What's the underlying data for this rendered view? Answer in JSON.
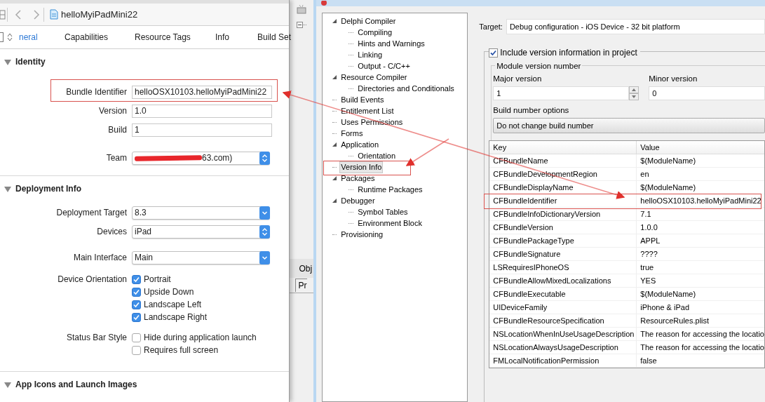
{
  "xcode": {
    "file_name": "helloMyiPadMini22",
    "tabs": [
      {
        "label": "neral",
        "selected": true
      },
      {
        "label": "Capabilities",
        "selected": false
      },
      {
        "label": "Resource Tags",
        "selected": false
      },
      {
        "label": "Info",
        "selected": false
      },
      {
        "label": "Build Set",
        "selected": false
      }
    ],
    "sections": [
      {
        "title": "Identity",
        "expanded": true,
        "rows": [
          {
            "kind": "text",
            "label": "Bundle Identifier",
            "value": "helloOSX10103.helloMyiPadMini22"
          },
          {
            "kind": "text",
            "label": "Version",
            "value": "1.0"
          },
          {
            "kind": "text",
            "label": "Build",
            "value": "1"
          },
          {
            "kind": "popup",
            "label": "Team",
            "value": "63.com)",
            "redacted": true
          }
        ]
      },
      {
        "title": "Deployment Info",
        "expanded": true,
        "rows": [
          {
            "kind": "combo",
            "label": "Deployment Target",
            "value": "8.3"
          },
          {
            "kind": "popup",
            "label": "Devices",
            "value": "iPad"
          },
          {
            "kind": "combo",
            "label": "Main Interface",
            "value": "Main"
          },
          {
            "kind": "checks",
            "label": "Device Orientation",
            "options": [
              {
                "label": "Portrait",
                "checked": true
              },
              {
                "label": "Upside Down",
                "checked": true
              },
              {
                "label": "Landscape Left",
                "checked": true
              },
              {
                "label": "Landscape Right",
                "checked": true
              }
            ]
          },
          {
            "kind": "checks",
            "label": "Status Bar Style",
            "options": [
              {
                "label": "Hide during application launch",
                "checked": false
              },
              {
                "label": "Requires full screen",
                "checked": false
              }
            ]
          }
        ]
      },
      {
        "title": "App Icons and Launch Images",
        "expanded": true
      }
    ]
  },
  "background_ide": {
    "tabs": [
      "Obj",
      "Pr"
    ]
  },
  "dialog": {
    "tree": [
      {
        "label": "Delphi Compiler",
        "expanded": true,
        "selected": false,
        "children": [
          {
            "label": "Compiling",
            "selected": false
          },
          {
            "label": "Hints and Warnings",
            "selected": false
          },
          {
            "label": "Linking",
            "selected": false
          },
          {
            "label": "Output - C/C++",
            "selected": false
          }
        ]
      },
      {
        "label": "Resource Compiler",
        "expanded": true,
        "selected": false,
        "children": [
          {
            "label": "Directories and Conditionals",
            "selected": false
          }
        ]
      },
      {
        "label": "Build Events",
        "selected": false
      },
      {
        "label": "Entitlement List",
        "selected": false
      },
      {
        "label": "Uses Permissions",
        "selected": false
      },
      {
        "label": "Forms",
        "selected": false
      },
      {
        "label": "Application",
        "expanded": true,
        "selected": false,
        "children": [
          {
            "label": "Orientation",
            "selected": false
          }
        ]
      },
      {
        "label": "Version Info",
        "selected": true
      },
      {
        "label": "Packages",
        "expanded": true,
        "selected": false,
        "children": [
          {
            "label": "Runtime Packages",
            "selected": false
          }
        ]
      },
      {
        "label": "Debugger",
        "expanded": true,
        "selected": false,
        "children": [
          {
            "label": "Symbol Tables",
            "selected": false
          },
          {
            "label": "Environment Block",
            "selected": false
          }
        ]
      },
      {
        "label": "Provisioning",
        "selected": false
      }
    ],
    "target": {
      "label": "Target:",
      "value": "Debug configuration - iOS Device - 32 bit platform"
    },
    "include_version": {
      "label": "Include version information in project",
      "checked": true
    },
    "module_group": "Module version number",
    "major": {
      "label": "Major version",
      "value": "1"
    },
    "minor": {
      "label": "Minor version",
      "value": "0"
    },
    "build_options": {
      "label": "Build number options",
      "value": "Do not change build number"
    },
    "table": {
      "columns": [
        "Key",
        "Value"
      ],
      "rows": [
        [
          "CFBundleName",
          "$(ModuleName)"
        ],
        [
          "CFBundleDevelopmentRegion",
          "en"
        ],
        [
          "CFBundleDisplayName",
          "$(ModuleName)"
        ],
        [
          "CFBundleIdentifier",
          "helloOSX10103.helloMyiPadMini22"
        ],
        [
          "CFBundleInfoDictionaryVersion",
          "7.1"
        ],
        [
          "CFBundleVersion",
          "1.0.0"
        ],
        [
          "CFBundlePackageType",
          "APPL"
        ],
        [
          "CFBundleSignature",
          "????"
        ],
        [
          "LSRequiresIPhoneOS",
          "true"
        ],
        [
          "CFBundleAllowMixedLocalizations",
          "YES"
        ],
        [
          "CFBundleExecutable",
          "$(ModuleName)"
        ],
        [
          "UIDeviceFamily",
          "iPhone & iPad"
        ],
        [
          "CFBundleResourceSpecification",
          "ResourceRules.plist"
        ],
        [
          "NSLocationWhenInUseUsageDescription",
          "The reason for accessing the locatio"
        ],
        [
          "NSLocationAlwaysUsageDescription",
          "The reason for accessing the locatio"
        ],
        [
          "FMLocalNotificationPermission",
          "false"
        ]
      ]
    }
  }
}
